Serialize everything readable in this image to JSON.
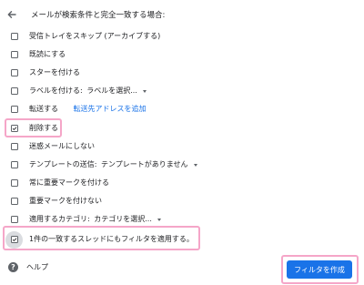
{
  "header": {
    "text": "メールが検索条件と完全一致する場合:",
    "back_icon": "arrow-left-icon"
  },
  "options": [
    {
      "id": "skip-inbox",
      "label": "受信トレイをスキップ (アーカイブする)",
      "checked": false
    },
    {
      "id": "mark-read",
      "label": "既読にする",
      "checked": false
    },
    {
      "id": "star",
      "label": "スターを付ける",
      "checked": false
    },
    {
      "id": "apply-label",
      "label": "ラベルを付ける:",
      "dropdown": "ラベルを選択...",
      "checked": false
    },
    {
      "id": "forward",
      "label": "転送する",
      "link": "転送先アドレスを追加",
      "checked": false
    },
    {
      "id": "delete",
      "label": "削除する",
      "checked": true
    },
    {
      "id": "never-spam",
      "label": "迷惑メールにしない",
      "checked": false
    },
    {
      "id": "send-template",
      "label": "テンプレートの送信:",
      "dropdown": "テンプレートがありません",
      "checked": false
    },
    {
      "id": "always-important",
      "label": "常に重要マークを付ける",
      "checked": false
    },
    {
      "id": "never-important",
      "label": "重要マークを付けない",
      "checked": false
    },
    {
      "id": "categorize",
      "label": "適用するカテゴリ:",
      "dropdown": "カテゴリを選択...",
      "checked": false
    },
    {
      "id": "apply-existing",
      "label": "1件の一致するスレッドにもフィルタを適用する。",
      "checked": true
    }
  ],
  "footer": {
    "help_label": "ヘルプ",
    "help_icon": "help-circle-icon",
    "create_button_label": "フィルタを作成"
  },
  "colors": {
    "accent": "#1a73e8",
    "highlight": "#f5a6c8",
    "text": "#202124",
    "icon": "#5f6368"
  }
}
